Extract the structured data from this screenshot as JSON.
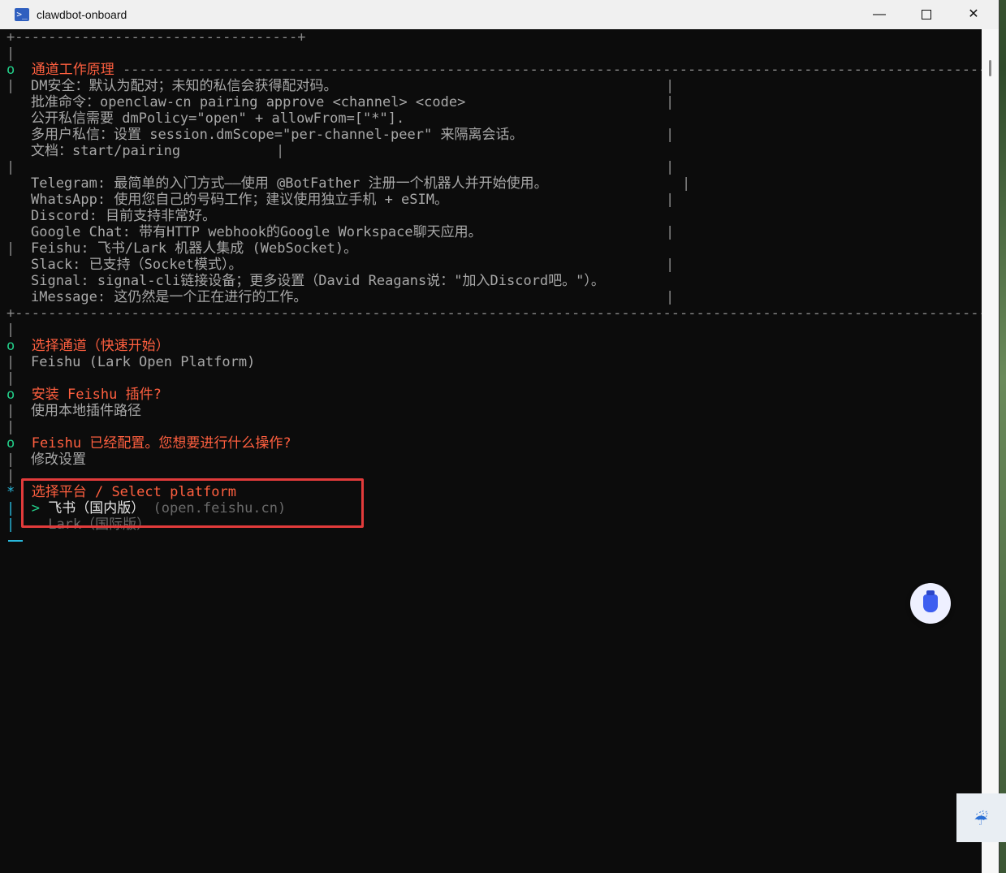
{
  "window": {
    "title": "clawdbot-onboard",
    "minimize_glyph": "—",
    "close_glyph": "✕"
  },
  "terminal": {
    "top_border": "+----------------------------------+",
    "pipe": "|",
    "section_marker": "o",
    "active_marker": "*",
    "info_box": {
      "title": "通道工作原理",
      "title_rule": " -------------------------------------------------------------------------------------------------------------+",
      "lines": [
        "DM安全：默认为配对；未知的私信会获得配对码。",
        "批准命令：openclaw-cn pairing approve <channel> <code>",
        "公开私信需要 dmPolicy=\"open\" + allowFrom=[\"*\"].",
        "多用户私信：设置 session.dmScope=\"per-channel-peer\" 来隔离会话。",
        "文档：start/pairing",
        "",
        "Telegram: 最简单的入门方式——使用 @BotFather 注册一个机器人并开始使用。",
        "WhatsApp: 使用您自己的号码工作；建议使用独立手机 + eSIM。",
        "Discord: 目前支持非常好。",
        "Google Chat: 带有HTTP webhook的Google Workspace聊天应用。",
        "Feishu: 飞书/Lark 机器人集成 (WebSocket)。",
        "Slack: 已支持（Socket模式）。",
        "Signal: signal-cli链接设备；更多设置（David Reagans说：\"加入Discord吧。\"）。",
        "iMessage: 这仍然是一个正在进行的工作。"
      ],
      "bottom_border": "+-----------------------------------------------------------------------------------------------------------------------+"
    },
    "steps": [
      {
        "question": "选择通道（快速开始）",
        "answer": "Feishu (Lark Open Platform)"
      },
      {
        "question": "安装 Feishu 插件?",
        "answer": "使用本地插件路径"
      },
      {
        "question": "Feishu 已经配置。您想要进行什么操作?",
        "answer": "修改设置"
      }
    ],
    "prompt": {
      "question": "选择平台 / Select platform",
      "pointer": ">",
      "options": [
        {
          "label": "飞书（国内版）",
          "hint": "(open.feishu.cn)"
        },
        {
          "label": "Lark（国际版）"
        }
      ]
    }
  },
  "colors": {
    "highlight_border": "#e23b3b",
    "question_color": "#ff5f3f",
    "marker_green": "#23d18b",
    "marker_cyan": "#29b8db"
  }
}
